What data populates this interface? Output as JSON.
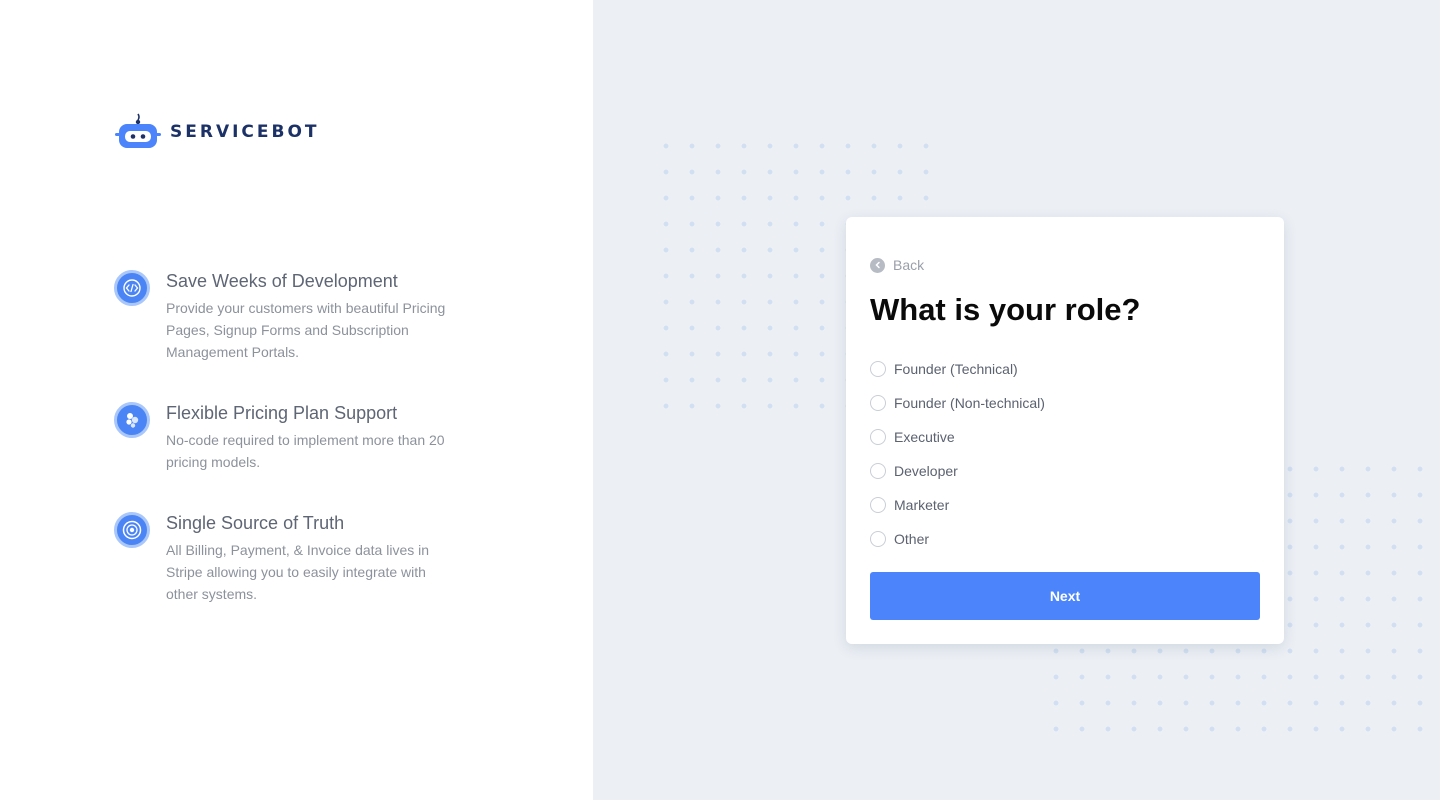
{
  "brand": {
    "name": "SERVICEBOT"
  },
  "colors": {
    "accent": "#4b84fb",
    "brand_text": "#1c3166",
    "right_bg": "#ecf0f5"
  },
  "features": [
    {
      "icon": "code-icon",
      "title": "Save Weeks of Development",
      "description": "Provide your customers with beautiful Pricing Pages, Signup Forms and Subscription Management Portals."
    },
    {
      "icon": "bubbles-icon",
      "title": "Flexible Pricing Plan Support",
      "description": "No-code required to implement more than 20 pricing models."
    },
    {
      "icon": "target-icon",
      "title": "Single Source of Truth",
      "description": "All Billing, Payment, & Invoice data lives in Stripe allowing you to easily integrate with other systems."
    }
  ],
  "form": {
    "back_label": "Back",
    "heading": "What is your role?",
    "options": [
      {
        "label": "Founder (Technical)"
      },
      {
        "label": "Founder (Non-technical)"
      },
      {
        "label": "Executive"
      },
      {
        "label": "Developer"
      },
      {
        "label": "Marketer"
      },
      {
        "label": "Other"
      }
    ],
    "next_label": "Next"
  }
}
